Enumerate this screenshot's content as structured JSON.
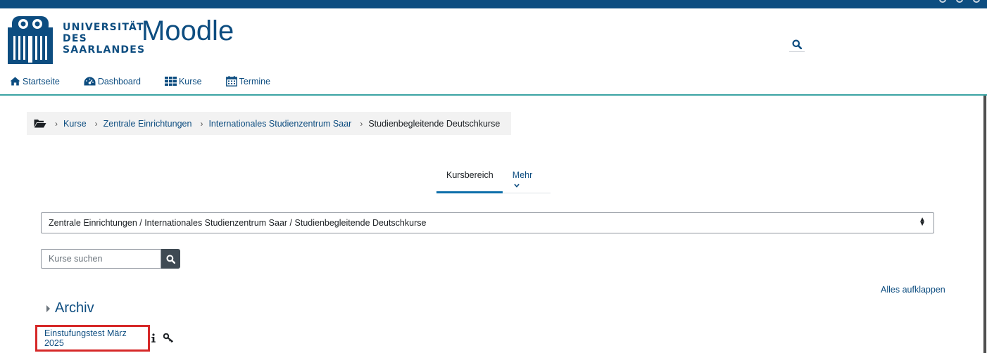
{
  "header": {
    "university_lines": [
      "UNIVERSITÄT",
      "DES",
      "SAARLANDES"
    ],
    "site_title": "Moodle"
  },
  "nav": [
    {
      "label": "Startseite",
      "icon": "home-icon"
    },
    {
      "label": "Dashboard",
      "icon": "dashboard-icon"
    },
    {
      "label": "Kurse",
      "icon": "grid-icon"
    },
    {
      "label": "Termine",
      "icon": "calendar-icon"
    }
  ],
  "breadcrumb": {
    "items": [
      "Kurse",
      "Zentrale Einrichtungen",
      "Internationales Studienzentrum Saar"
    ],
    "current": "Studienbegleitende Deutschkurse"
  },
  "tabs": {
    "active": "Kursbereich",
    "more": "Mehr"
  },
  "category_select": {
    "selected": "Zentrale Einrichtungen / Internationales Studienzentrum Saar / Studienbegleitende Deutschkurse"
  },
  "course_search": {
    "placeholder": "Kurse suchen"
  },
  "expand_all": "Alles aufklappen",
  "category": {
    "name": "Archiv"
  },
  "course": {
    "name": "Einstufungstest März 2025"
  },
  "colors": {
    "brand": "#0d4d80",
    "accent_line": "#3ba3a3",
    "highlight": "#d62828"
  }
}
